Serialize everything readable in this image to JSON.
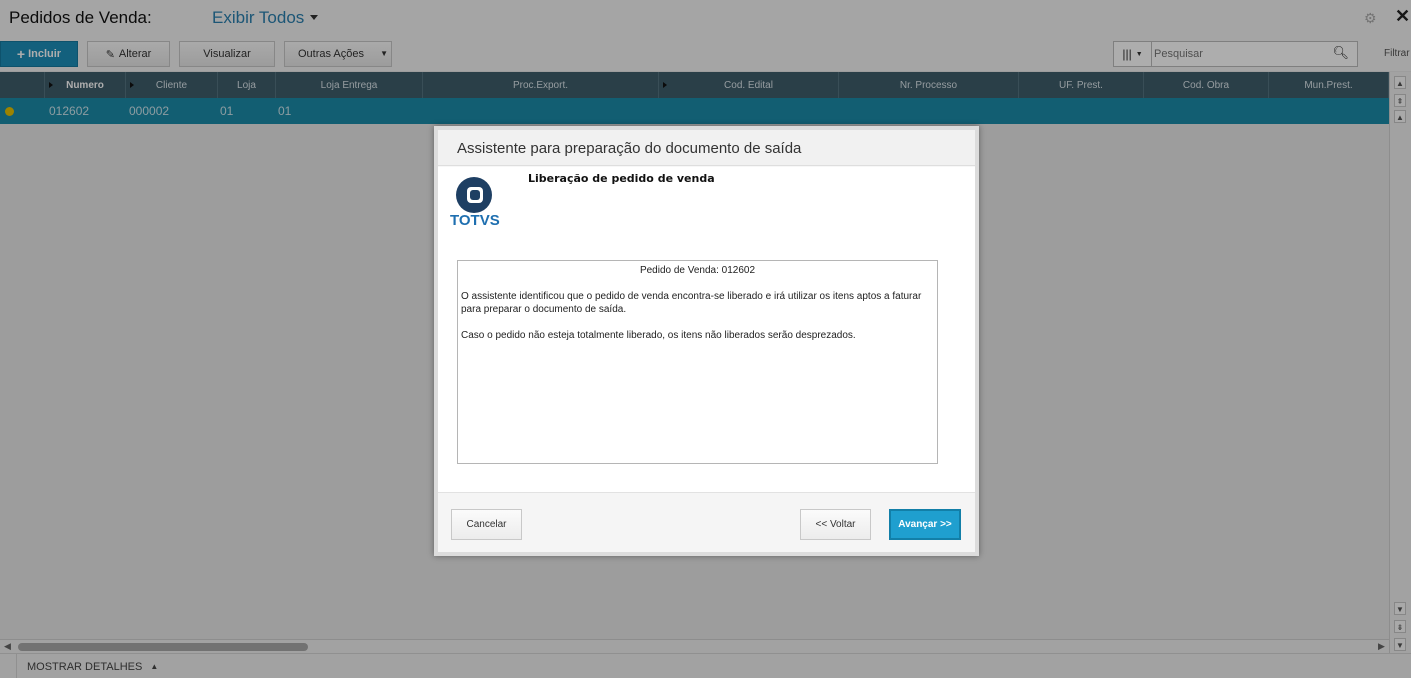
{
  "header": {
    "title": "Pedidos de Venda:",
    "view_label": "Exibir Todos"
  },
  "toolbar": {
    "incluir_label": "Incluir",
    "alterar_label": "Alterar",
    "visualizar_label": "Visualizar",
    "outras_label": "Outras Ações",
    "search_placeholder": "Pesquisar",
    "filtrar_label": "Filtrar"
  },
  "grid": {
    "columns": [
      "Numero",
      "Cliente",
      "Loja",
      "Loja Entrega",
      "Proc.Export.",
      "Cod. Edital",
      "Nr. Processo",
      "UF. Prest.",
      "Cod. Obra",
      "Mun.Prest."
    ],
    "rows": [
      {
        "numero": "012602",
        "cliente": "000002",
        "loja": "01",
        "loja_entrega": "01"
      }
    ]
  },
  "footer": {
    "details_label": "MOSTRAR DETALHES"
  },
  "dialog": {
    "title": "Assistente para preparação do documento de saída",
    "logo_text": "TOTVS",
    "subtitle": "Liberação de pedido de venda",
    "order_line": "Pedido de Venda: 012602",
    "paragraph1": "O assistente identificou que o pedido de venda encontra-se liberado e irá utilizar os itens aptos a faturar para preparar o documento de saída.",
    "paragraph2": "Caso o pedido não esteja totalmente liberado, os itens não liberados serão desprezados.",
    "cancel_label": "Cancelar",
    "back_label": "<< Voltar",
    "next_label": "Avançar >>"
  },
  "colors": {
    "accent": "#1d8eb8",
    "grid_header": "#3f5d6b",
    "selected_row": "#1b8ba8",
    "status_dot": "#e6c100"
  }
}
